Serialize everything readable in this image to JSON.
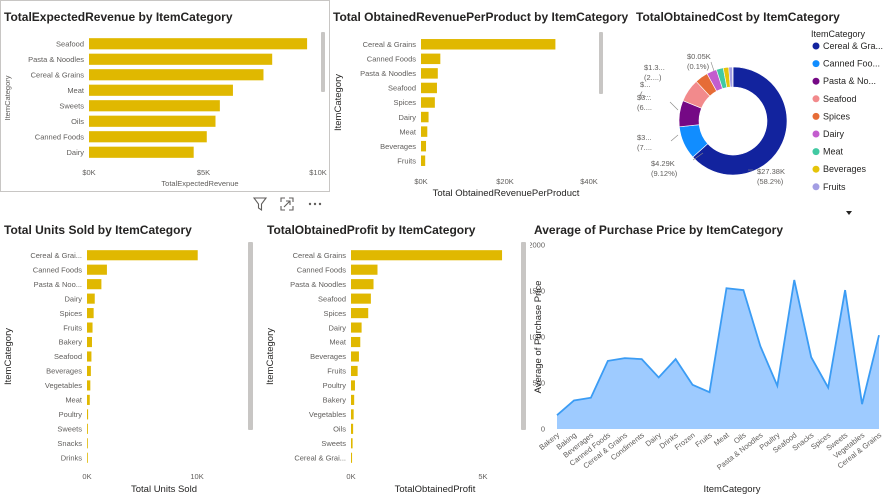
{
  "colors": {
    "bar": "#e0b800",
    "area_fill": "#9ecbff",
    "area_stroke": "#3b9cf4",
    "grid": "#e8e8e8"
  },
  "visual_toolbar": {
    "icons": [
      "filter-icon",
      "focus-mode-icon",
      "more-options-icon"
    ]
  },
  "chart_data": [
    {
      "id": "expected_revenue",
      "type": "bar",
      "orientation": "horizontal",
      "title": "TotalExpectedRevenue by ItemCategory",
      "xlabel": "TotalExpectedRevenue",
      "ylabel": "ItemCategory",
      "categories": [
        "Seafood",
        "Pasta & Noodles",
        "Cereal & Grains",
        "Meat",
        "Sweets",
        "Oils",
        "Canned Foods",
        "Dairy"
      ],
      "values": [
        10000,
        8400,
        8000,
        6600,
        6000,
        5800,
        5400,
        4800
      ],
      "xticks": [
        "$0K",
        "$5K",
        "$10K"
      ],
      "xlim": [
        0,
        10500
      ]
    },
    {
      "id": "obtained_revenue_per_product",
      "type": "bar",
      "orientation": "horizontal",
      "title": "Total ObtainedRevenuePerProduct by ItemCategory",
      "xlabel": "Total ObtainedRevenuePerProduct",
      "ylabel": "ItemCategory",
      "categories": [
        "Cereal & Grains",
        "Canned Foods",
        "Pasta & Noodles",
        "Seafood",
        "Spices",
        "Dairy",
        "Meat",
        "Beverages",
        "Fruits"
      ],
      "values": [
        32000,
        4600,
        4000,
        3800,
        3300,
        1800,
        1500,
        1200,
        1000
      ],
      "xticks": [
        "$0K",
        "$20K",
        "$40K"
      ],
      "xlim": [
        0,
        40000
      ]
    },
    {
      "id": "obtained_cost",
      "type": "pie",
      "donut": true,
      "title": "TotalObtainedCost by ItemCategory",
      "legend_title": "ItemCategory",
      "legend_position": "right",
      "slices": [
        {
          "name": "Cereal & Gra...",
          "value": 27380,
          "color": "#12239e",
          "label": "$27.38K",
          "pct": "(58.2%)"
        },
        {
          "name": "Canned Foo...",
          "value": 4290,
          "color": "#118dff",
          "label": "$4.29K",
          "pct": "(9.12%)"
        },
        {
          "name": "Pasta & No...",
          "value": 3400,
          "color": "#750985",
          "label": "$3...",
          "pct": "(7...."
        },
        {
          "name": "Seafood",
          "value": 3000,
          "color": "#f28a8c",
          "label": "$3...",
          "pct": "(6...."
        },
        {
          "name": "Spices",
          "value": 1700,
          "color": "#e66c37",
          "label": "$...",
          "pct": "(...."
        },
        {
          "name": "Dairy",
          "value": 1300,
          "color": "#c35dce",
          "label": "$1.3...",
          "pct": "(2....)"
        },
        {
          "name": "Meat",
          "value": 900,
          "color": "#41c9a2",
          "label": "",
          "pct": ""
        },
        {
          "name": "Beverages",
          "value": 700,
          "color": "#e5c40a",
          "label": "",
          "pct": ""
        },
        {
          "name": "Fruits",
          "value": 500,
          "color": "#a39ee3",
          "label": "",
          "pct": ""
        },
        {
          "name": "",
          "value": 50,
          "color": "#66c2e0",
          "label": "$0.05K",
          "pct": "(0.1%)"
        }
      ]
    },
    {
      "id": "units_sold",
      "type": "bar",
      "orientation": "horizontal",
      "title": "Total Units Sold by ItemCategory",
      "xlabel": "Total Units Sold",
      "ylabel": "ItemCategory",
      "categories": [
        "Cereal & Grai...",
        "Canned Foods",
        "Pasta & Noo...",
        "Dairy",
        "Spices",
        "Fruits",
        "Bakery",
        "Seafood",
        "Beverages",
        "Vegetables",
        "Meat",
        "Poultry",
        "Sweets",
        "Snacks",
        "Drinks"
      ],
      "values": [
        10000,
        1800,
        1300,
        700,
        600,
        500,
        450,
        400,
        350,
        300,
        250,
        100,
        80,
        60,
        40
      ],
      "xticks": [
        "0K",
        "10K"
      ],
      "xlim": [
        0,
        14000
      ]
    },
    {
      "id": "obtained_profit",
      "type": "bar",
      "orientation": "horizontal",
      "title": "TotalObtainedProfit by ItemCategory",
      "xlabel": "TotalObtainedProfit",
      "ylabel": "ItemCategory",
      "categories": [
        "Cereal & Grains",
        "Canned Foods",
        "Pasta & Noodles",
        "Seafood",
        "Spices",
        "Dairy",
        "Meat",
        "Beverages",
        "Fruits",
        "Poultry",
        "Bakery",
        "Vegetables",
        "Oils",
        "Sweets",
        "Cereal & Grai..."
      ],
      "values": [
        5700,
        1000,
        850,
        750,
        650,
        400,
        350,
        300,
        250,
        150,
        120,
        100,
        80,
        60,
        40
      ],
      "xticks": [
        "0K",
        "5K"
      ],
      "xlim": [
        0,
        6000
      ]
    },
    {
      "id": "avg_purchase_price",
      "type": "area",
      "title": "Average of Purchase Price by ItemCategory",
      "xlabel": "ItemCategory",
      "ylabel": "Average of Purchase Price",
      "categories": [
        "Bakery",
        "Baking",
        "Beverages",
        "Canned Foods",
        "Cereal & Grains",
        "Condiments",
        "Dairy",
        "Drinks",
        "Frozen",
        "Fruits",
        "Meat",
        "Oils",
        "Pasta & Noodles",
        "Poultry",
        "Seafood",
        "Snacks",
        "Spices",
        "Sweets",
        "Vegetables",
        "Cereal & Grains"
      ],
      "values": [
        150,
        310,
        340,
        740,
        770,
        760,
        560,
        760,
        480,
        400,
        1530,
        1510,
        900,
        470,
        1620,
        780,
        450,
        1510,
        270,
        1020
      ],
      "yticks": [
        "0",
        "500",
        "1000",
        "1500",
        "2000"
      ],
      "ylim": [
        0,
        2000
      ]
    }
  ]
}
